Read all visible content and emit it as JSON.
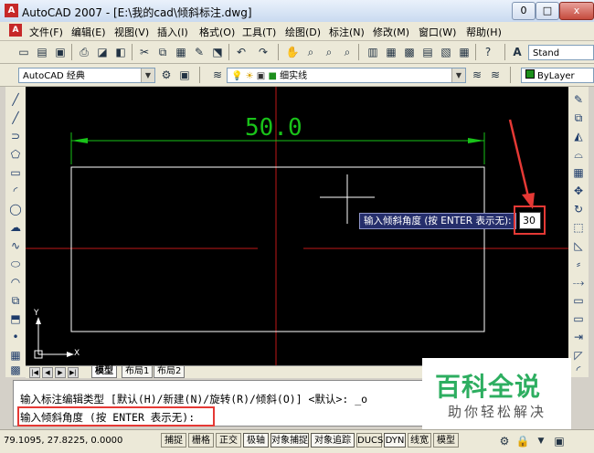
{
  "window": {
    "title": "AutoCAD 2007 - [E:\\我的cad\\倾斜标注.dwg]",
    "controls": {
      "minimize": "0",
      "restore": "□",
      "close": "x"
    }
  },
  "menu": {
    "items": [
      "文件(F)",
      "编辑(E)",
      "视图(V)",
      "插入(I)",
      "格式(O)",
      "工具(T)",
      "绘图(D)",
      "标注(N)",
      "修改(M)",
      "窗口(W)",
      "帮助(H)"
    ]
  },
  "toolbar": {
    "text_style": "Stand",
    "workspace": "AutoCAD 经典",
    "layer": "细实线",
    "color": "ByLayer"
  },
  "drawing": {
    "dimension_text": "50.0",
    "ucs_x": "X",
    "ucs_y": "Y"
  },
  "dynamic_input": {
    "prompt": "输入倾斜角度 (按 ENTER 表示无):",
    "value": "30"
  },
  "tabs": {
    "model": "模型",
    "layout1": "布局1",
    "layout2": "布局2"
  },
  "command": {
    "history_line": "输入标注编辑类型 [默认(H)/新建(N)/旋转(R)/倾斜(O)] <默认>: _o",
    "current_prompt": "输入倾斜角度 (按 ENTER 表示无):",
    "cursor": ""
  },
  "status": {
    "coordinates": "79.1095,  27.8225, 0.0000",
    "buttons": [
      "捕捉",
      "栅格",
      "正交",
      "极轴",
      "对象捕捉",
      "对象追踪",
      "DUCS",
      "DYN",
      "线宽",
      "模型"
    ]
  },
  "watermark": {
    "title": "百科全说",
    "subtitle": "助你轻松解决"
  },
  "colors": {
    "dimension": "#19c219",
    "center_line": "#c01818",
    "annotation": "#e53935"
  }
}
